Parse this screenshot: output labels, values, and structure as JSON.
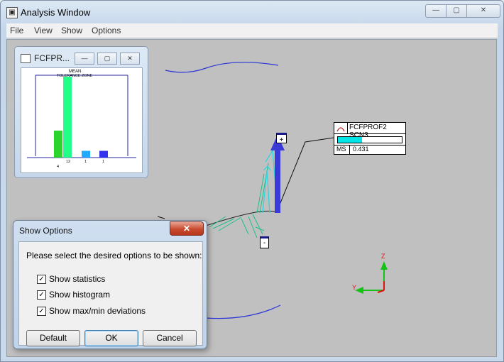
{
  "window": {
    "title": "Analysis Window",
    "icon": "app-icon",
    "min_label": "—",
    "max_label": "▢",
    "close_label": "✕"
  },
  "menu": [
    "File",
    "View",
    "Show",
    "Options"
  ],
  "mini_window": {
    "title": "FCFPR...",
    "min_label": "—",
    "max_label": "▢",
    "close_label": "✕",
    "chart_data": {
      "type": "bar",
      "title": "MEAN",
      "subtitle": "TOLERANCE ZONE",
      "values": [
        4,
        12,
        1,
        1
      ],
      "value_labels": [
        "4",
        "12",
        "1",
        "1"
      ],
      "colors": [
        "#2bd42b",
        "#22ff88",
        "#22aaff",
        "#3333ee"
      ]
    }
  },
  "label_box": {
    "name": "FCFPROF2 SCN3",
    "row_label": "MS",
    "value": "0.431",
    "gauge_level": 0.38,
    "gauge_color": "#00e5e5"
  },
  "markers": {
    "plus": "+",
    "minus": "-"
  },
  "triad": {
    "z": "Z",
    "y": "Y"
  },
  "dialog": {
    "title": "Show Options",
    "close_label": "✕",
    "prompt": "Please select the desired options to be shown:",
    "options": [
      {
        "label": "Show statistics",
        "checked": true
      },
      {
        "label": "Show histogram",
        "checked": true
      },
      {
        "label": "Show max/min deviations",
        "checked": true
      }
    ],
    "buttons": {
      "default": "Default",
      "ok": "OK",
      "cancel": "Cancel"
    }
  }
}
